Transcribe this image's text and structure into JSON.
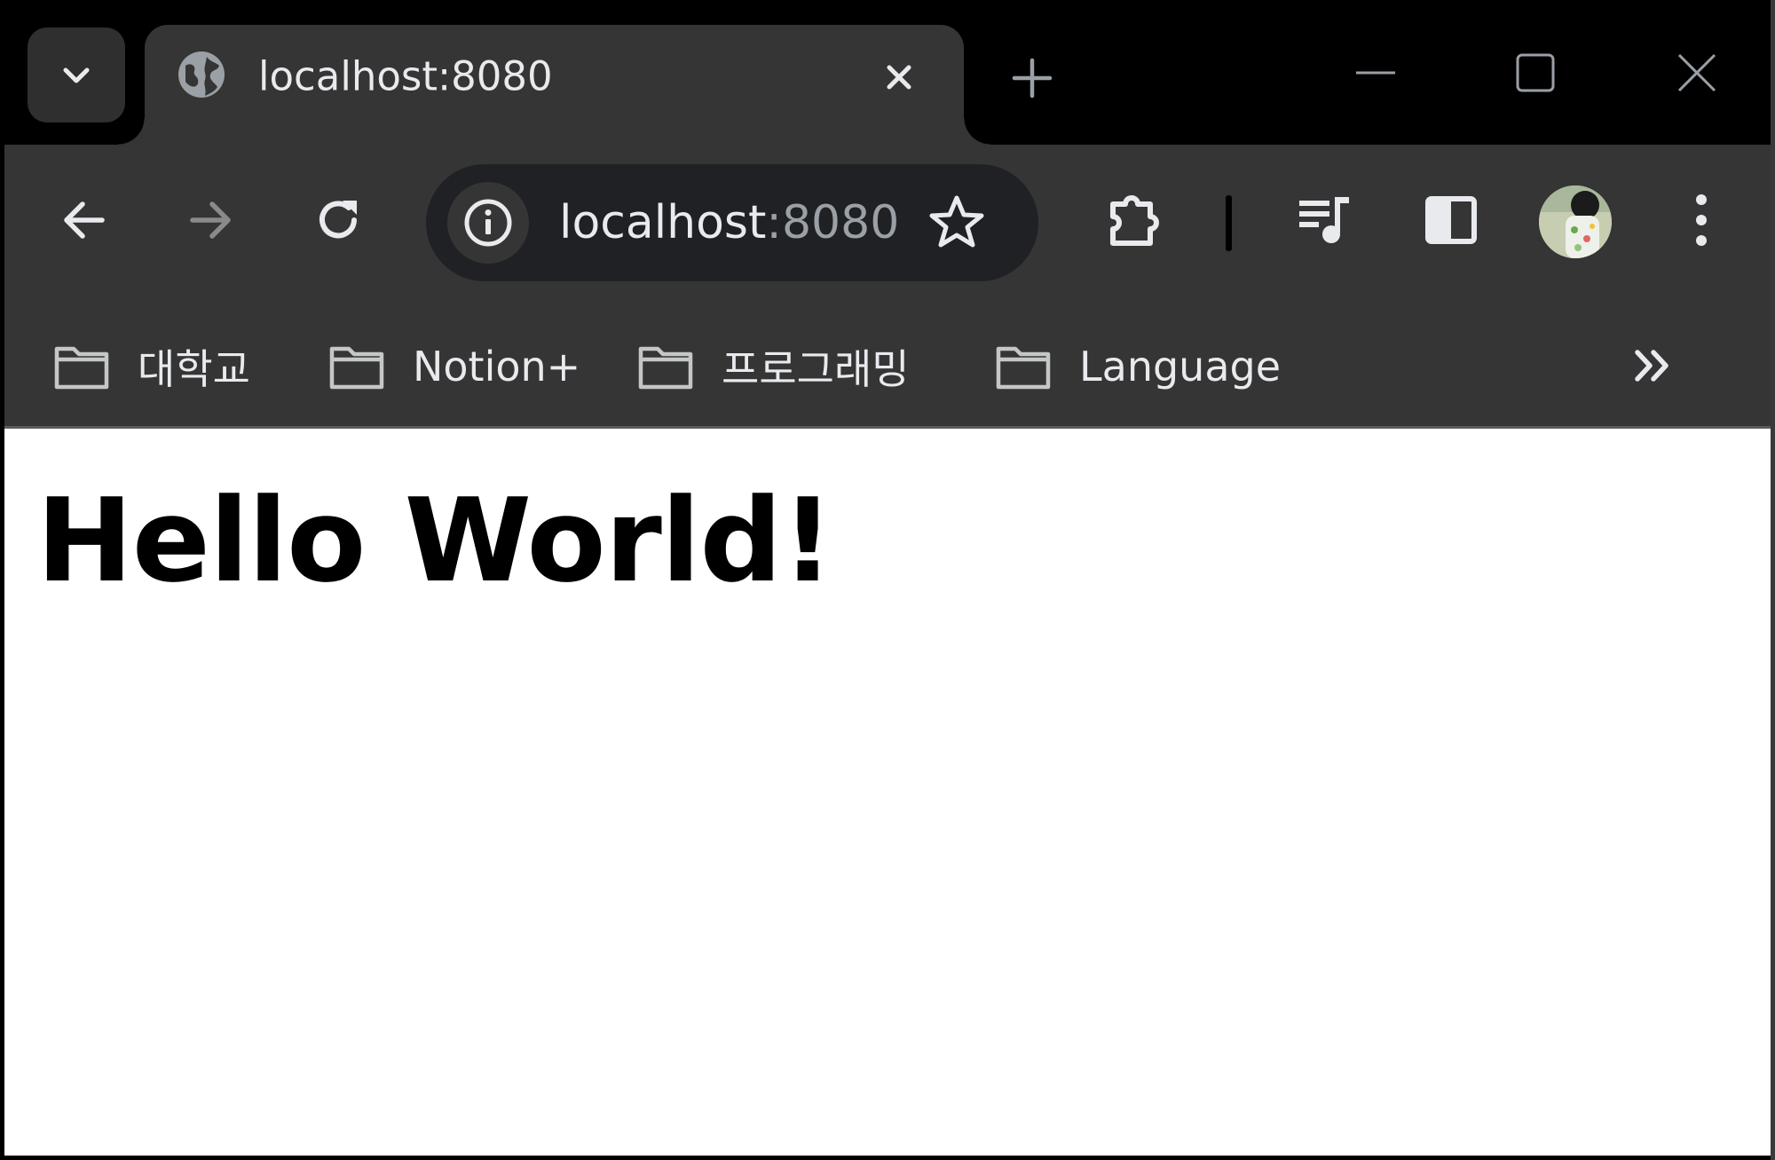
{
  "colors": {
    "frame": "#000000",
    "tab_active": "#353535",
    "toolbar": "#353535",
    "omnibox": "#202124",
    "text_light": "#e8eaed",
    "text_dim": "#9aa0a6",
    "page_background": "#ffffff"
  },
  "tabstrip": {
    "search_tabs_icon": "chevron-down-icon",
    "tab": {
      "favicon_icon": "globe-icon",
      "title": "localhost:8080",
      "close_icon": "close-icon"
    },
    "new_tab_icon": "plus-icon",
    "window_controls": {
      "minimize_icon": "minimize-icon",
      "maximize_icon": "maximize-icon",
      "close_icon": "close-icon"
    }
  },
  "toolbar": {
    "back_icon": "arrow-left-icon",
    "forward_icon": "arrow-right-icon",
    "reload_icon": "reload-icon",
    "omnibox": {
      "info_icon": "info-icon",
      "host": "localhost",
      "port": ":8080",
      "bookmark_icon": "star-icon"
    },
    "extensions_icon": "puzzle-icon",
    "media_icon": "media-queue-icon",
    "side_panel_icon": "side-panel-icon",
    "profile_icon": "avatar",
    "menu_icon": "kebab-menu-icon"
  },
  "bookmarks": {
    "items": [
      {
        "label": "대학교",
        "icon": "folder-icon"
      },
      {
        "label": "Notion+",
        "icon": "folder-icon"
      },
      {
        "label": "프로그래밍",
        "icon": "folder-icon"
      },
      {
        "label": "Language",
        "icon": "folder-icon"
      }
    ],
    "overflow_icon": "double-chevron-right-icon"
  },
  "page": {
    "heading": "Hello World!"
  }
}
